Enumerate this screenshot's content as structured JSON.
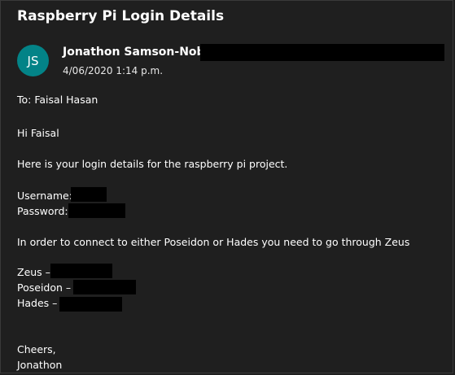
{
  "email": {
    "subject": "Raspberry Pi Login Details",
    "sender": {
      "initials": "JS",
      "name": "Jonathon Samson-Noble",
      "avatar_color": "#038387"
    },
    "sent_date": "4/06/2020 1:14 p.m.",
    "to_line": "To: Faisal Hasan",
    "body": {
      "greeting": "Hi Faisal",
      "intro": "Here is your login details for the raspberry pi project.",
      "username_label": "Username:",
      "password_label": "Password:",
      "instruction": "In order to connect to either Poseidon or Hades you need to go through Zeus",
      "zeus_label": "Zeus –",
      "poseidon_label": "Poseidon –",
      "hades_label": "Hades –",
      "closing": "Cheers,",
      "signature": "Jonathon"
    }
  }
}
